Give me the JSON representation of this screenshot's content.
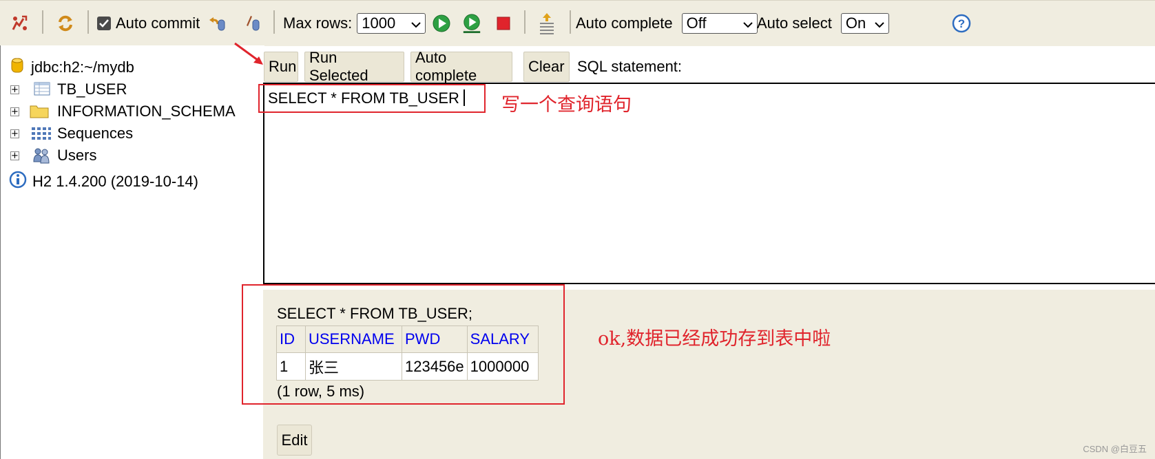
{
  "toolbar": {
    "auto_commit_label": "Auto commit",
    "auto_commit_checked": true,
    "max_rows_label": "Max rows:",
    "max_rows_value": "1000",
    "auto_complete_label": "Auto complete",
    "auto_complete_value": "Off",
    "auto_select_label": "Auto select",
    "auto_select_value": "On"
  },
  "tree": {
    "connection": "jdbc:h2:~/mydb",
    "items": [
      {
        "label": "TB_USER",
        "icon": "table-icon"
      },
      {
        "label": "INFORMATION_SCHEMA",
        "icon": "folder-icon"
      },
      {
        "label": "Sequences",
        "icon": "sequences-icon"
      },
      {
        "label": "Users",
        "icon": "users-icon"
      }
    ],
    "version": "H2 1.4.200 (2019-10-14)"
  },
  "actions": {
    "run": "Run",
    "run_selected": "Run Selected",
    "auto_complete": "Auto complete",
    "clear": "Clear",
    "sql_statement_label": "SQL statement:"
  },
  "editor": {
    "text": "SELECT * FROM TB_USER"
  },
  "results": {
    "query": "SELECT * FROM TB_USER;",
    "columns": [
      "ID",
      "USERNAME",
      "PWD",
      "SALARY"
    ],
    "rows": [
      [
        "1",
        "张三",
        "123456e",
        "1000000"
      ]
    ],
    "summary": "(1 row, 5 ms)",
    "edit_label": "Edit"
  },
  "annotations": {
    "query_note": "写一个查询语句",
    "result_note": "ok,数据已经成功存到表中啦",
    "color": "#e0242c"
  },
  "watermark": "CSDN @白豆五"
}
